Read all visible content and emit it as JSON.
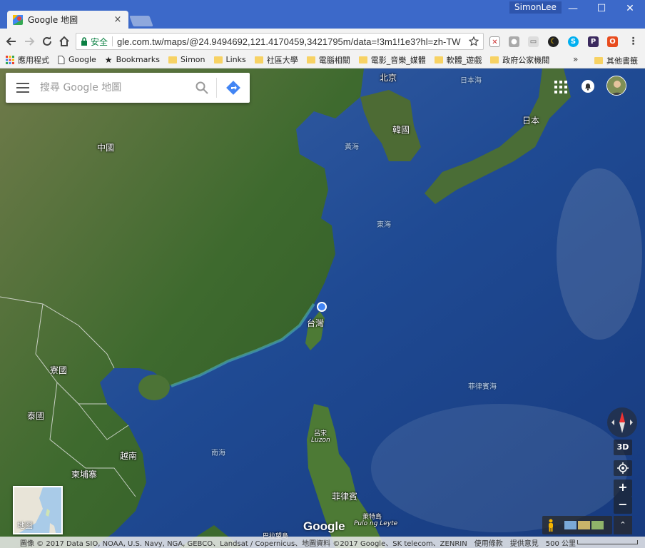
{
  "browser": {
    "tab_title": "Google 地圖",
    "tab_close": "×",
    "user": "SimonLee",
    "window": {
      "minimize": "—",
      "maximize": "☐",
      "close": "✕"
    },
    "secure_label": "安全",
    "url": "gle.com.tw/maps/@24.9494692,121.4170459,3421795m/data=!3m1!1e3?hl=zh-TW"
  },
  "bookmarks": {
    "items": [
      {
        "label": "應用程式",
        "icon": "apps-grid-icon"
      },
      {
        "label": "Google",
        "icon": "page-icon"
      },
      {
        "label": "Bookmarks",
        "icon": "star-icon"
      },
      {
        "label": "Simon",
        "icon": "folder-icon"
      },
      {
        "label": "Links",
        "icon": "folder-icon"
      },
      {
        "label": "社區大學",
        "icon": "folder-icon"
      },
      {
        "label": "電腦相關",
        "icon": "folder-icon"
      },
      {
        "label": "電影_音樂_媒體",
        "icon": "folder-icon"
      },
      {
        "label": "軟體_遊戲",
        "icon": "folder-icon"
      },
      {
        "label": "政府公家機關",
        "icon": "folder-icon"
      }
    ],
    "more": "»",
    "other": "其他書籤"
  },
  "map": {
    "search_placeholder": "搜尋 Google 地圖",
    "labels": {
      "china": "中國",
      "beijing": "北京",
      "korea": "韓國",
      "japan": "日本",
      "japan_sea": "日本海",
      "yellow_sea": "黃海",
      "east_sea": "東海",
      "taiwan": "台灣",
      "laos": "寮國",
      "thailand": "泰國",
      "vietnam": "越南",
      "cambodia": "柬埔寨",
      "south_sea": "南海",
      "philippine_sea": "菲律賓海",
      "luzon_zh": "呂宋",
      "luzon_en": "Luzon",
      "philippines": "菲律賓",
      "palawan_zh": "巴拉望島",
      "leyte_zh": "萊特島",
      "leyte_en": "Pulo ng Leyte"
    },
    "controls": {
      "view_3d": "3D",
      "zoom_in": "+",
      "zoom_out": "−",
      "expand": "⌃"
    },
    "minimap_label": "地圖",
    "logo": "Google"
  },
  "footer": {
    "imagery": "圖像 © 2017 Data SIO, NOAA, U.S. Navy, NGA, GEBCO、Landsat / Copernicus、地圖資料 ©2017 Google、SK telecom、ZENRIN",
    "terms": "使用條款",
    "feedback": "提供意見",
    "scale": "500 公里"
  },
  "colors": {
    "titlebar": "#3c69c9",
    "accent_blue": "#4285f4",
    "secure_green": "#0b8043"
  }
}
